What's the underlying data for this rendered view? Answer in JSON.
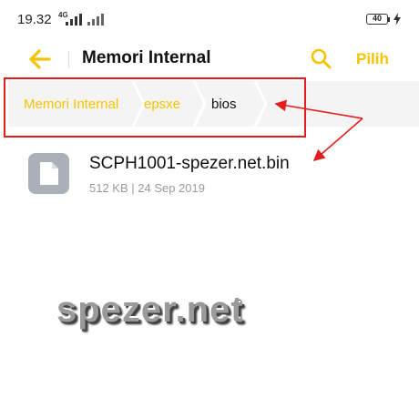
{
  "status": {
    "time": "19.32",
    "network": "4G",
    "battery": "40"
  },
  "header": {
    "title": "Memori Internal",
    "select_label": "Pilih"
  },
  "breadcrumb": {
    "items": [
      "Memori Internal",
      "epsxe",
      "bios"
    ]
  },
  "files": [
    {
      "name": "SCPH1001-spezer.net.bin",
      "meta": "512 KB | 24 Sep 2019"
    }
  ],
  "watermark": "spezer.net",
  "colors": {
    "accent": "#F5C400",
    "annotation": "#E41E1E"
  },
  "icons": {
    "back": "arrow-left-icon",
    "search": "search-icon",
    "file": "document-icon"
  }
}
